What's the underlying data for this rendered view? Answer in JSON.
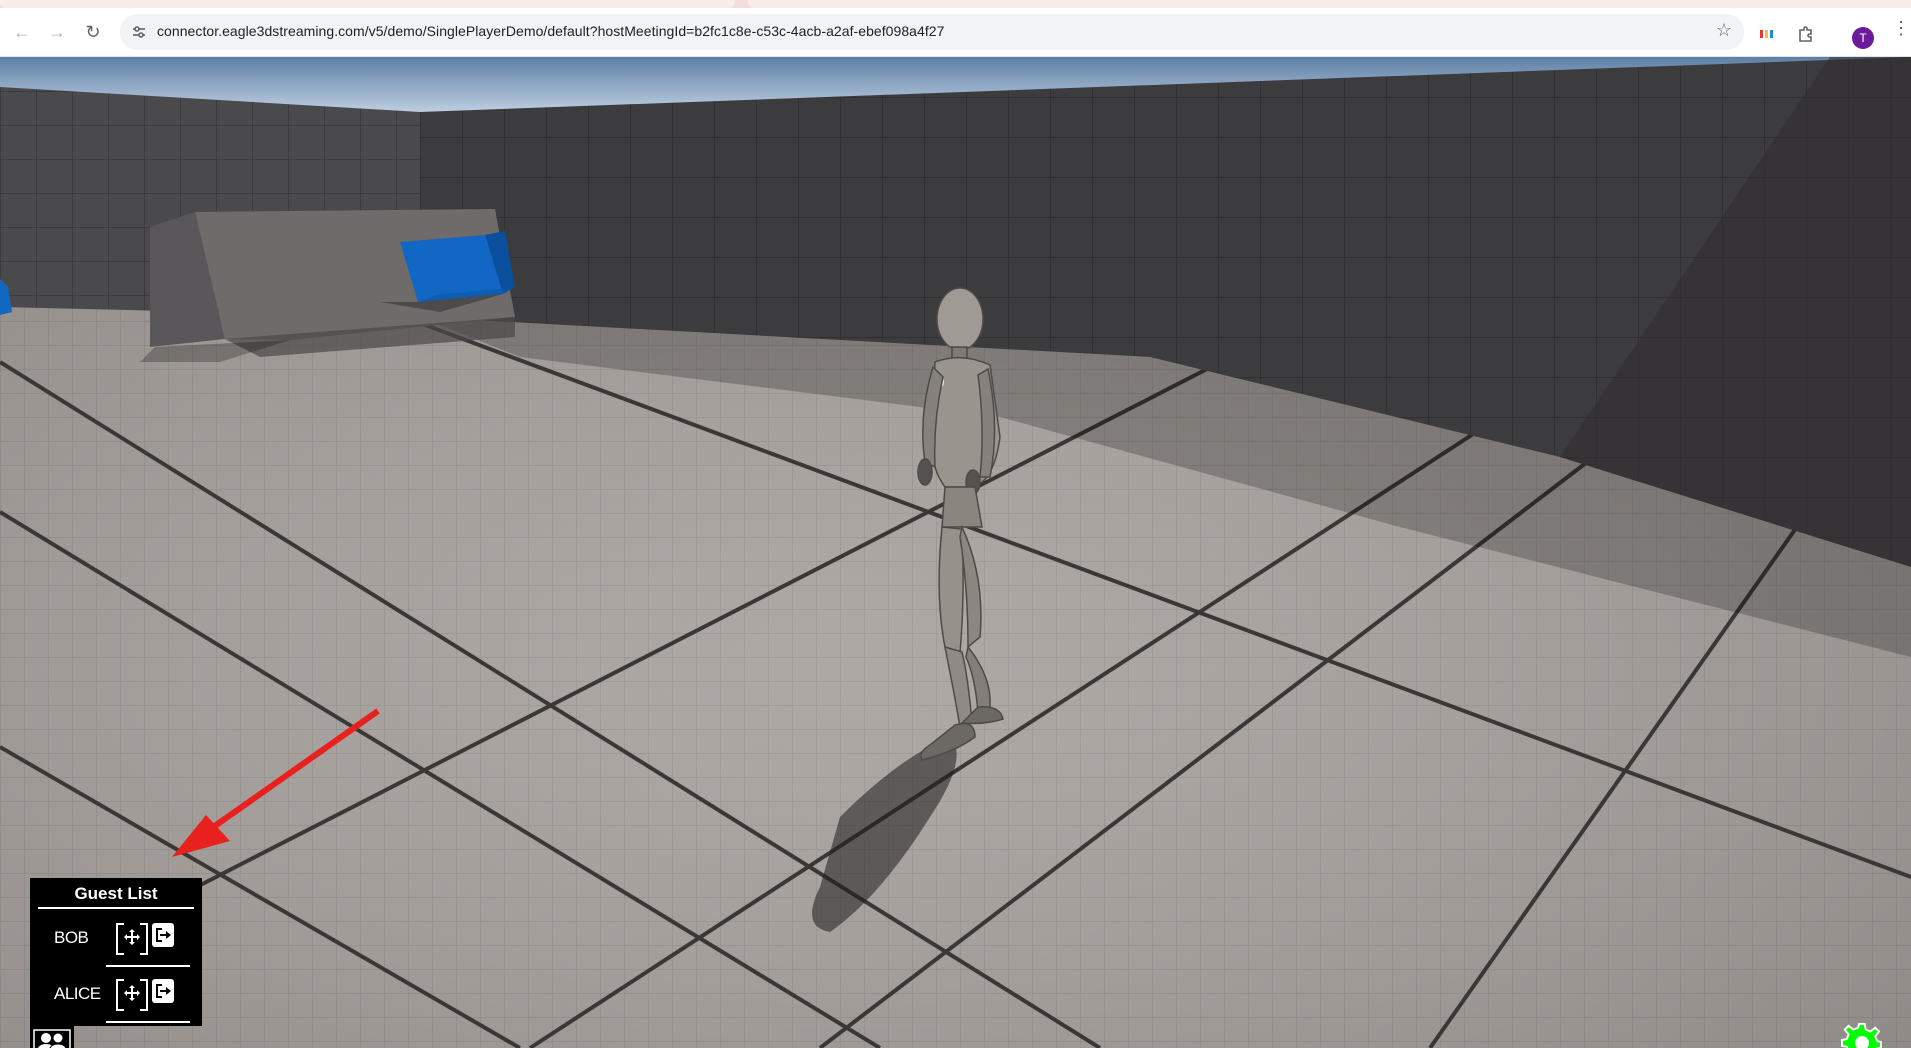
{
  "browser": {
    "url": "connector.eagle3dstreaming.com/v5/demo/SinglePlayerDemo/default?hostMeetingId=b2fc1c8e-c53c-4acb-a2af-ebef098a4f27",
    "profile_initial": "T"
  },
  "guest_list": {
    "title": "Guest List",
    "guests": [
      {
        "name": "BOB"
      },
      {
        "name": "ALICE"
      }
    ]
  },
  "colors": {
    "settings_gear": "#00ff00",
    "annotation_arrow": "#e8201e",
    "panel_bg": "#000000",
    "profile_avatar": "#6a1b9a"
  },
  "icons": {
    "move": "move-arrows-icon",
    "exit": "exit-arrow-icon",
    "guests_toggle": "people-icon",
    "settings": "gear-icon"
  }
}
